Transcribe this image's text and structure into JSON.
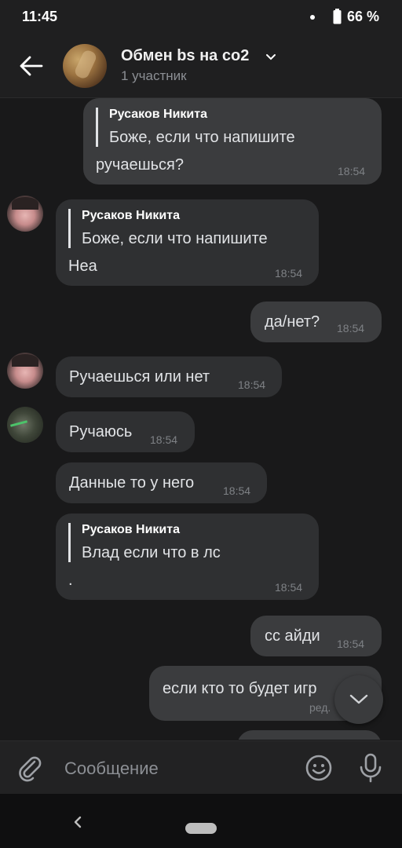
{
  "status": {
    "time": "11:45",
    "battery": "66 %"
  },
  "header": {
    "title": "Обмен bs на co2",
    "subtitle": "1 участник"
  },
  "messages": [
    {
      "id": "m1",
      "quote_author": "Русаков Никита",
      "quote_text": "Боже, если что напишите",
      "text": "ручаешься?",
      "time": "18:54"
    },
    {
      "id": "m2",
      "quote_author": "Русаков Никита",
      "quote_text": "Боже, если что напишите",
      "text": "Неа",
      "time": "18:54"
    },
    {
      "id": "m3",
      "text": "да/нет?",
      "time": "18:54"
    },
    {
      "id": "m4",
      "text": "Ручаешься или нет",
      "time": "18:54"
    },
    {
      "id": "m5",
      "text": "Ручаюсь",
      "time": "18:54"
    },
    {
      "id": "m6",
      "text": "Данные то у него",
      "time": "18:54"
    },
    {
      "id": "m7",
      "quote_author": "Русаков Никита",
      "quote_text": "Влад если что в лс",
      "text": ".",
      "time": "18:54"
    },
    {
      "id": "m8",
      "text": "сс айди",
      "time": "18:54"
    },
    {
      "id": "m9",
      "text": "если кто то будет игр",
      "time": "ред."
    }
  ],
  "composer": {
    "placeholder": "Сообщение"
  },
  "icons": {
    "back": "arrow-left-icon",
    "chevron": "chevron-down-icon",
    "attach": "paperclip-icon",
    "emoji": "smile-icon",
    "mic": "microphone-icon",
    "scroll": "chevron-down-icon"
  }
}
